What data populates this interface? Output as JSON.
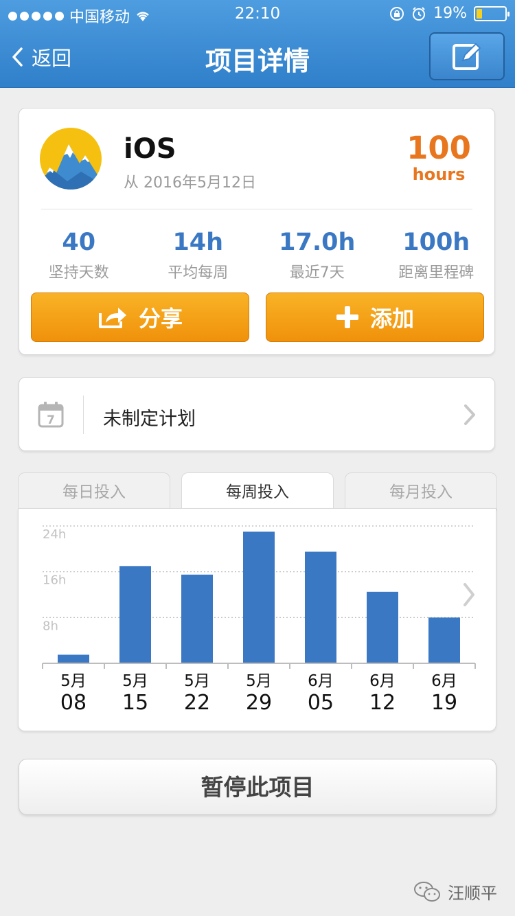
{
  "status_bar": {
    "carrier": "中国移动",
    "time": "22:10",
    "battery": "19%",
    "battery_level": 0.19
  },
  "nav": {
    "back_label": "返回",
    "title": "项目详情",
    "edit_icon": "edit-icon"
  },
  "project": {
    "name": "iOS",
    "since": "从 2016年5月12日",
    "total_value": "100",
    "total_unit": "hours",
    "stats": [
      {
        "value": "40",
        "label": "坚持天数"
      },
      {
        "value": "14h",
        "label": "平均每周"
      },
      {
        "value": "17.0h",
        "label": "最近7天"
      },
      {
        "value": "100h",
        "label": "距离里程碑"
      }
    ],
    "share_label": "分享",
    "add_label": "添加"
  },
  "plan": {
    "label": "未制定计划",
    "calendar_day": "7"
  },
  "tabs": {
    "daily": "每日投入",
    "weekly": "每周投入",
    "monthly": "每月投入",
    "active": "weekly"
  },
  "chart_data": {
    "type": "bar",
    "categories": [
      {
        "month": "5月",
        "day": "08"
      },
      {
        "month": "5月",
        "day": "15"
      },
      {
        "month": "5月",
        "day": "22"
      },
      {
        "month": "5月",
        "day": "29"
      },
      {
        "month": "6月",
        "day": "05"
      },
      {
        "month": "6月",
        "day": "12"
      },
      {
        "month": "6月",
        "day": "19"
      }
    ],
    "values": [
      1.5,
      17,
      15.5,
      23,
      19.5,
      12.5,
      8
    ],
    "yticks": [
      "8h",
      "16h",
      "24h"
    ],
    "ytick_values": [
      8,
      16,
      24
    ],
    "ylim": [
      0,
      24
    ],
    "grid": true,
    "bar_color": "#3b78c4"
  },
  "pause_label": "暂停此项目",
  "watermark": "汪顺平",
  "colors": {
    "accent_blue": "#3b78c4",
    "header_blue": "#3a8ad4",
    "orange": "#e8761e",
    "button_orange": "#f5a019"
  }
}
